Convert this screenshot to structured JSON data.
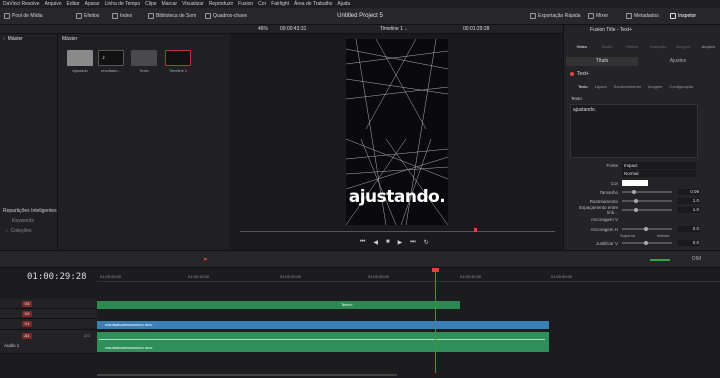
{
  "menu": [
    "DaVinci Resolve",
    "Arquivo",
    "Editar",
    "Aparar",
    "Linha de Tempo",
    "Clipe",
    "Marcar",
    "Visualizar",
    "Reproduzir",
    "Fusion",
    "Cor",
    "Fairlight",
    "Área de Trabalho",
    "Ajuda"
  ],
  "toolbar": {
    "left": [
      "Pool de Mídia",
      "Efeitos",
      "Index",
      "Biblioteca de Som",
      "Quadros-chave"
    ],
    "project_title": "Untitled Project 5",
    "right": [
      "Exportação Rápida",
      "Mixer",
      "Metadados",
      "Inspetor"
    ]
  },
  "subbar": {
    "zoom": "46%",
    "source_tc": "00:00:43:31",
    "timeline_name": "Timeline 1",
    "rec_tc": "00:01:29:28"
  },
  "left_panel": {
    "master": "Máster",
    "smart_bins": "Repartições Inteligentes",
    "keywords": "Keywords",
    "collections": "Coleções"
  },
  "media_pool": {
    "header": "Máster",
    "clips": [
      "Ajustado",
      "resultado...",
      "Texto",
      "Timeline 1"
    ]
  },
  "viewer": {
    "overlay_text": "ajustando."
  },
  "inspector": {
    "title": "Fusion Title - Text+",
    "tabs": [
      "Vídeo",
      "Áudio",
      "Efeitos",
      "Transição",
      "Imagem",
      "Arquivo"
    ],
    "subtabs": [
      "Título",
      "Ajustes"
    ],
    "node": "Text+",
    "sections": [
      "Texto",
      "Layout",
      "Sombreamento",
      "Imagem",
      "Configuração"
    ],
    "text_header": "Texto",
    "text_value": "ajustando.",
    "rows": [
      {
        "label": "Fonte",
        "value": "Impact"
      },
      {
        "label": "",
        "value": "Normal"
      },
      {
        "label": "Cor",
        "value": ""
      },
      {
        "label": "Tamanho",
        "value": "0.09"
      },
      {
        "label": "Rastreamento",
        "value": "1.0"
      },
      {
        "label": "Espaçamento entre linh...",
        "value": "1.0"
      },
      {
        "label": "Ancoragem V",
        "value": ""
      },
      {
        "label": "Ancoragem H",
        "value": "0.0"
      },
      {
        "label": "Justificar V",
        "value": "0.0"
      }
    ],
    "anchor_labels": [
      "Superior",
      "Inferior"
    ]
  },
  "timeline": {
    "timecode": "01:00:29:28",
    "ruler": [
      "01:00:00:00",
      "01:00:10:00",
      "01:00:20:00",
      "01:00:30:00",
      "01:00:40:00",
      "01:00:50:00"
    ],
    "tracks": [
      "V3",
      "V2",
      "V1",
      "A1"
    ],
    "audio_name": "Áudio 1",
    "audio_level": "2.0",
    "clip_v1": "resultadoarmamosmo.mov",
    "clip_a1": "resultadoarmamosmo.mov",
    "title_label": "Texto+",
    "dim": "DIM"
  },
  "colors": {
    "accent": "#e0443a",
    "video_clip": "#3a7fb5",
    "audio_clip": "#2f8f5a",
    "title_clip": "#2a8a52"
  }
}
